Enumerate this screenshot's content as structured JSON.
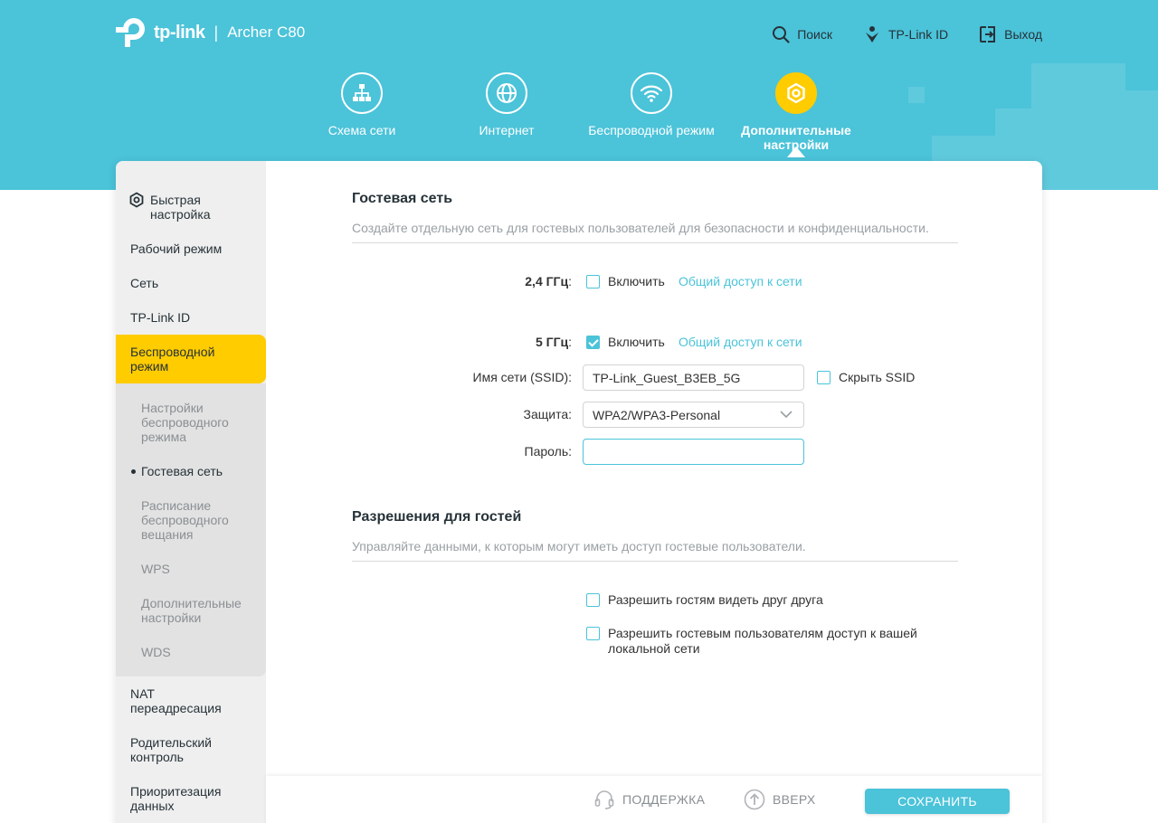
{
  "brand": {
    "logo_text": "tp-link",
    "separator": "|",
    "model": "Archer C80"
  },
  "top_links": {
    "search": "Поиск",
    "tplink_id": "TP-Link ID",
    "logout": "Выход"
  },
  "nav_tabs": [
    {
      "label": "Схема сети",
      "icon": "network-map-icon"
    },
    {
      "label": "Интернет",
      "icon": "globe-icon"
    },
    {
      "label": "Беспроводной режим",
      "icon": "wifi-icon"
    },
    {
      "label": "Дополнительные настройки",
      "icon": "gear-icon",
      "active": true
    }
  ],
  "sidebar": {
    "items": [
      {
        "label": "Быстрая настройка",
        "icon": "gear-icon"
      },
      {
        "label": "Рабочий режим"
      },
      {
        "label": "Сеть"
      },
      {
        "label": "TP-Link ID"
      },
      {
        "label": "Беспроводной режим",
        "active": true
      },
      {
        "label": "NAT переадресация"
      },
      {
        "label": "Родительский контроль"
      },
      {
        "label": "Приоритезация данных"
      }
    ],
    "sub_items": [
      {
        "label": "Настройки беспроводного режима"
      },
      {
        "label": "Гостевая сеть",
        "current": true
      },
      {
        "label": "Расписание беспроводного вещания"
      },
      {
        "label": "WPS"
      },
      {
        "label": "Дополнительные настройки"
      },
      {
        "label": "WDS"
      }
    ]
  },
  "guest_network": {
    "title": "Гостевая сеть",
    "description": "Создайте отдельную сеть для гостевых пользователей для безопасности и конфиденциальности.",
    "band_24": {
      "label": "2,4 ГГц",
      "colon": ":",
      "enable_label": "Включить",
      "enabled": false,
      "share_link": "Общий доступ к сети"
    },
    "band_5": {
      "label": "5 ГГц",
      "colon": ":",
      "enable_label": "Включить",
      "enabled": true,
      "share_link": "Общий доступ к сети"
    },
    "ssid": {
      "label": "Имя сети (SSID):",
      "value": "TP-Link_Guest_B3EB_5G",
      "hide_label": "Скрыть SSID",
      "hidden": false
    },
    "security": {
      "label": "Защита:",
      "value": "WPA2/WPA3-Personal"
    },
    "password": {
      "label": "Пароль:",
      "value": ""
    }
  },
  "guest_permissions": {
    "title": "Разрешения для гостей",
    "description": "Управляйте данными, к которым могут иметь доступ гостевые пользователи.",
    "see_each_other": {
      "label": "Разрешить гостям видеть друг друга",
      "checked": false
    },
    "local_access": {
      "label": "Разрешить гостевым пользователям доступ к вашей локальной сети",
      "checked": false
    }
  },
  "footer": {
    "support": "ПОДДЕРЖКА",
    "top": "ВВЕРХ",
    "save": "СОХРАНИТЬ"
  },
  "colors": {
    "accent": "#4bc3d9",
    "active": "#ffcc00",
    "text": "#263238"
  }
}
